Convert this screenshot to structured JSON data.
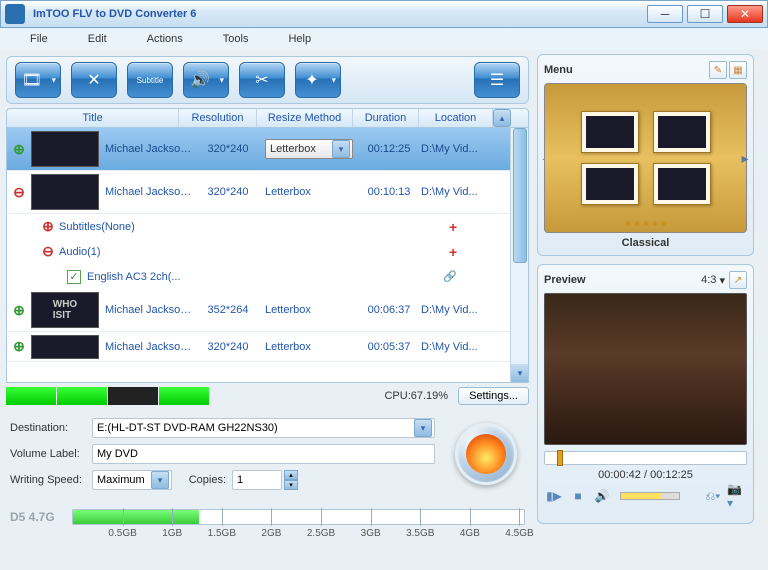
{
  "titlebar": {
    "title": "ImTOO FLV to DVD Converter 6"
  },
  "menubar": [
    "File",
    "Edit",
    "Actions",
    "Tools",
    "Help"
  ],
  "toolbar": {
    "add": "add-file",
    "remove": "remove",
    "subtitle": "subtitle",
    "audio": "audio",
    "cut": "cut",
    "effect": "effect",
    "list": "list"
  },
  "columns": {
    "title": "Title",
    "resolution": "Resolution",
    "resize": "Resize Method",
    "duration": "Duration",
    "location": "Location"
  },
  "rows": [
    {
      "title": "Michael Jackson...",
      "res": "320*240",
      "resize": "Letterbox",
      "dur": "00:12:25",
      "loc": "D:\\My Vid...",
      "sel": true,
      "exp": "+"
    },
    {
      "title": "Michael Jackson...",
      "res": "320*240",
      "resize": "Letterbox",
      "dur": "00:10:13",
      "loc": "D:\\My Vid...",
      "sel": false,
      "exp": "-"
    },
    {
      "title": "Michael Jackson...",
      "res": "352*264",
      "resize": "Letterbox",
      "dur": "00:06:37",
      "loc": "D:\\My Vid...",
      "sel": false,
      "exp": "+"
    },
    {
      "title": "Michael Jackson...",
      "res": "320*240",
      "resize": "Letterbox",
      "dur": "00:05:37",
      "loc": "D:\\My Vid...",
      "sel": false,
      "exp": "+"
    }
  ],
  "subrows": {
    "subtitles": "Subtitles(None)",
    "audio": "Audio(1)",
    "eng": "English AC3 2ch(..."
  },
  "infobar": {
    "cpu": "CPU:67.19%",
    "settings": "Settings..."
  },
  "form": {
    "dest_label": "Destination:",
    "dest_val": "E:(HL-DT-ST DVD-RAM GH22NS30)",
    "vol_label": "Volume Label:",
    "vol_val": "My DVD",
    "speed_label": "Writing Speed:",
    "speed_val": "Maximum",
    "copies_label": "Copies:",
    "copies_val": "1"
  },
  "capacity": {
    "disc": "D5 4.7G",
    "ticks": [
      "0.5GB",
      "1GB",
      "1.5GB",
      "2GB",
      "2.5GB",
      "3GB",
      "3.5GB",
      "4GB",
      "4.5GB"
    ]
  },
  "menu": {
    "title": "Menu",
    "template": "Classical"
  },
  "preview": {
    "title": "Preview",
    "aspect": "4:3",
    "time": "00:00:42 / 00:12:25"
  }
}
